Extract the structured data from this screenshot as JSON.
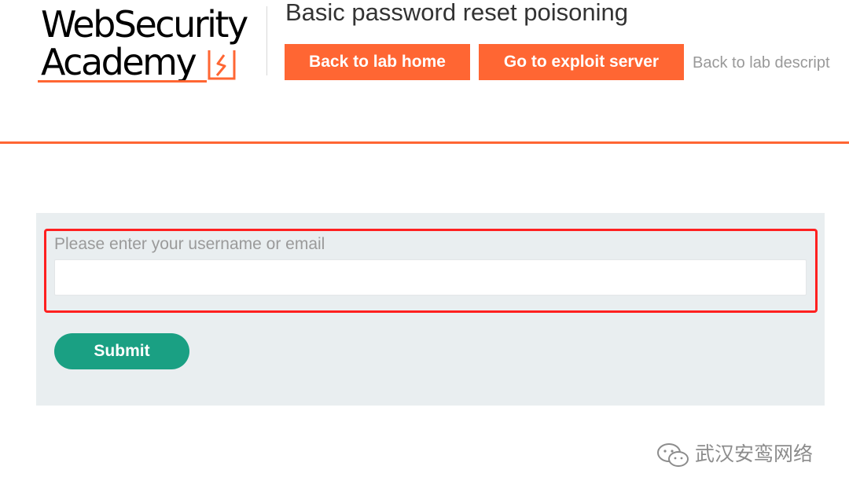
{
  "logo": {
    "line1": "WebSecurity",
    "line2": "Academy",
    "accent_color": "#ff6633"
  },
  "header": {
    "title": "Basic password reset poisoning",
    "back_button": "Back to lab home",
    "exploit_button": "Go to exploit server",
    "description_link": "Back to lab descript"
  },
  "form": {
    "field_label": "Please enter your username or email",
    "field_value": "",
    "submit_label": "Submit",
    "submit_color": "#1aa083"
  },
  "watermark": {
    "text": "武汉安鸾网络"
  }
}
